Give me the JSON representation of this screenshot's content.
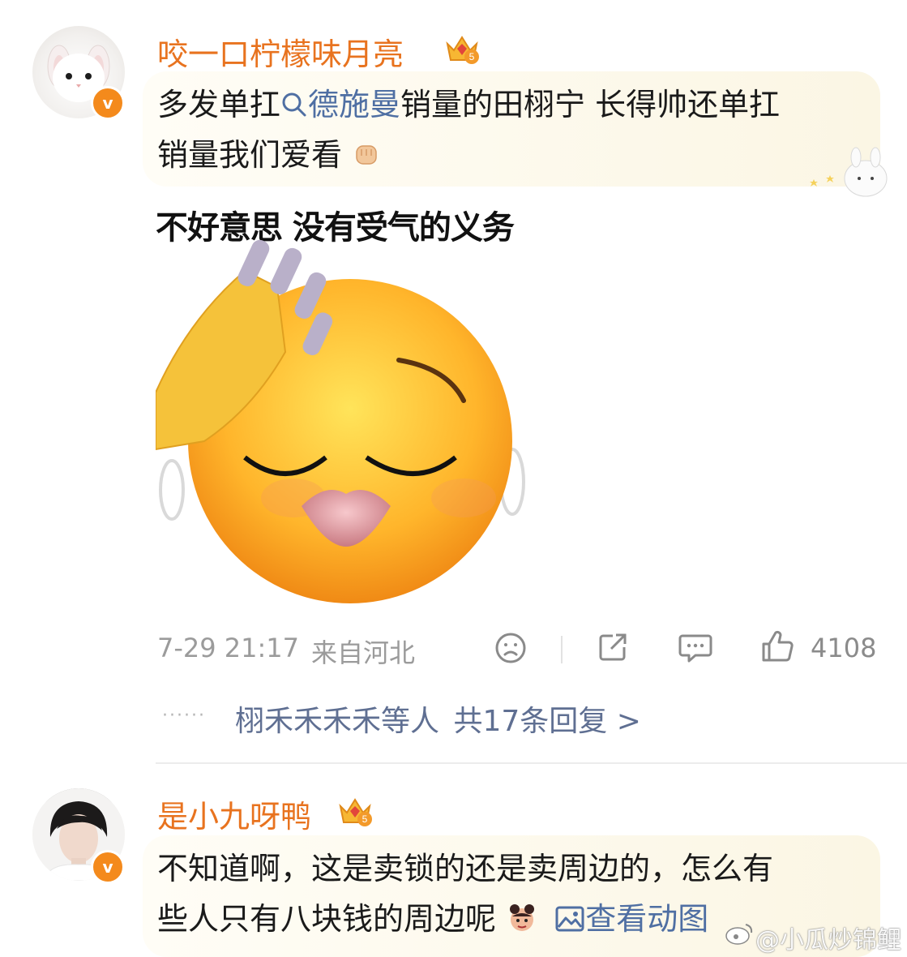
{
  "comments": [
    {
      "username": "咬一口柠檬味月亮",
      "badge_level": "5",
      "text_prefix": "多发单扛",
      "topic": "德施曼",
      "text_suffix_line1": "销量的田栩宁 长得帅还单扛",
      "text_line2": "销量我们爱看",
      "image_caption": "不好意思 没有受气的义务",
      "timestamp": "7-29 21:17",
      "location": "来自河北",
      "like_count": "4108",
      "replies_names": "栩禾禾禾禾等人",
      "replies_total": "共17条回复 >"
    },
    {
      "username": "是小九呀鸭",
      "badge_level": "5",
      "text_line1": "不知道啊，这是卖锁的还是卖周边的，怎么有",
      "text_line2": "些人只有八块钱的周边呢",
      "view_gif_label": "查看动图"
    }
  ],
  "watermark": "@小瓜炒锦鲤",
  "colors": {
    "username": "#e8731f",
    "link": "#4f6fa3",
    "meta": "#9b9b9b",
    "verified_badge": "#f48a1c"
  }
}
